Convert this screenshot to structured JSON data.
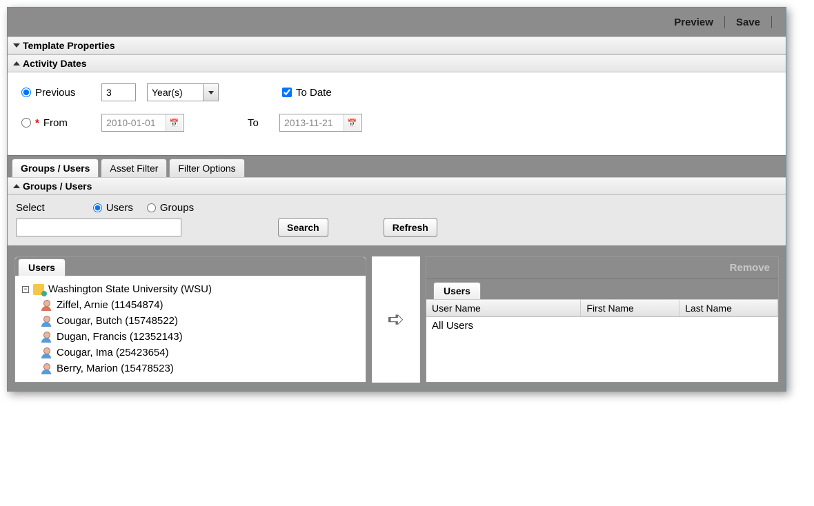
{
  "toolbar": {
    "preview": "Preview",
    "save": "Save"
  },
  "sections": {
    "template_properties": "Template Properties",
    "activity_dates": "Activity Dates",
    "groups_users": "Groups / Users"
  },
  "dates": {
    "previous_label": "Previous",
    "previous_value": "3",
    "unit_value": "Year(s)",
    "to_date_label": "To Date",
    "from_label": "From",
    "from_value": "2010-01-01",
    "to_label": "To",
    "to_value": "2013-11-21"
  },
  "tabs": {
    "groups_users": "Groups / Users",
    "asset_filter": "Asset Filter",
    "filter_options": "Filter Options"
  },
  "filter": {
    "select_label": "Select",
    "users_label": "Users",
    "groups_label": "Groups",
    "search_btn": "Search",
    "refresh_btn": "Refresh"
  },
  "left_panel": {
    "tab": "Users",
    "org": "Washington State University (WSU)",
    "users": [
      "Ziffel, Arnie (11454874)",
      "Cougar, Butch (15748522)",
      "Dugan, Francis (12352143)",
      "Cougar, Ima (25423654)",
      "Berry, Marion (15478523)"
    ]
  },
  "right_panel": {
    "remove": "Remove",
    "tab": "Users",
    "columns": {
      "user_name": "User Name",
      "first_name": "First Name",
      "last_name": "Last Name"
    },
    "rows": [
      {
        "user_name": "All Users"
      }
    ]
  }
}
